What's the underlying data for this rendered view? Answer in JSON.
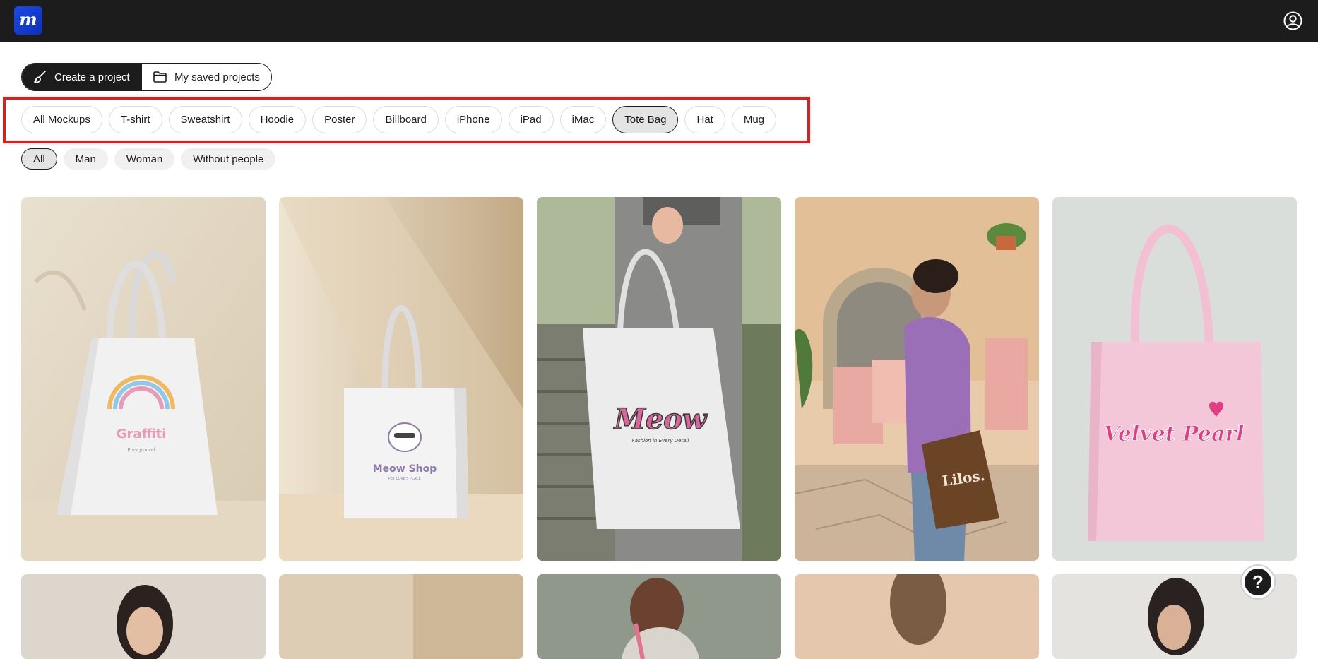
{
  "app": {
    "logo_letter": "m",
    "brand_color": "#1b4be0"
  },
  "project_tabs": [
    {
      "label": "Create a project",
      "icon": "brush-icon",
      "active": true
    },
    {
      "label": "My saved projects",
      "icon": "folder-icon",
      "active": false
    }
  ],
  "categories": [
    {
      "label": "All Mockups",
      "selected": false
    },
    {
      "label": "T-shirt",
      "selected": false
    },
    {
      "label": "Sweatshirt",
      "selected": false
    },
    {
      "label": "Hoodie",
      "selected": false
    },
    {
      "label": "Poster",
      "selected": false
    },
    {
      "label": "Billboard",
      "selected": false
    },
    {
      "label": "iPhone",
      "selected": false
    },
    {
      "label": "iPad",
      "selected": false
    },
    {
      "label": "iMac",
      "selected": false
    },
    {
      "label": "Tote Bag",
      "selected": true
    },
    {
      "label": "Hat",
      "selected": false
    },
    {
      "label": "Mug",
      "selected": false
    }
  ],
  "people_filters": [
    {
      "label": "All",
      "selected": true
    },
    {
      "label": "Man",
      "selected": false
    },
    {
      "label": "Woman",
      "selected": false
    },
    {
      "label": "Without people",
      "selected": false
    }
  ],
  "mockups": [
    {
      "design_text": "Graffiti",
      "design_subtext": "Playground",
      "bag_color": "#f1f1f1",
      "design_color": "#e89bb6"
    },
    {
      "design_text": "Meow Shop",
      "design_subtext": "PET LOVE'S PLACE",
      "bag_color": "#f3f3f3",
      "design_color": "#8e7aa8"
    },
    {
      "design_text": "Meow",
      "design_subtext": "Fashion in Every Detail",
      "bag_color": "#ececec",
      "design_color": "#d6679a"
    },
    {
      "design_text": "Lilos.",
      "design_subtext": "",
      "bag_color": "#6b4426",
      "design_color": "#f3e6d6"
    },
    {
      "design_text": "Velvet Pearl",
      "design_subtext": "",
      "bag_color": "#f4c7d8",
      "design_color": "#e23d83"
    }
  ],
  "help_label": "?"
}
